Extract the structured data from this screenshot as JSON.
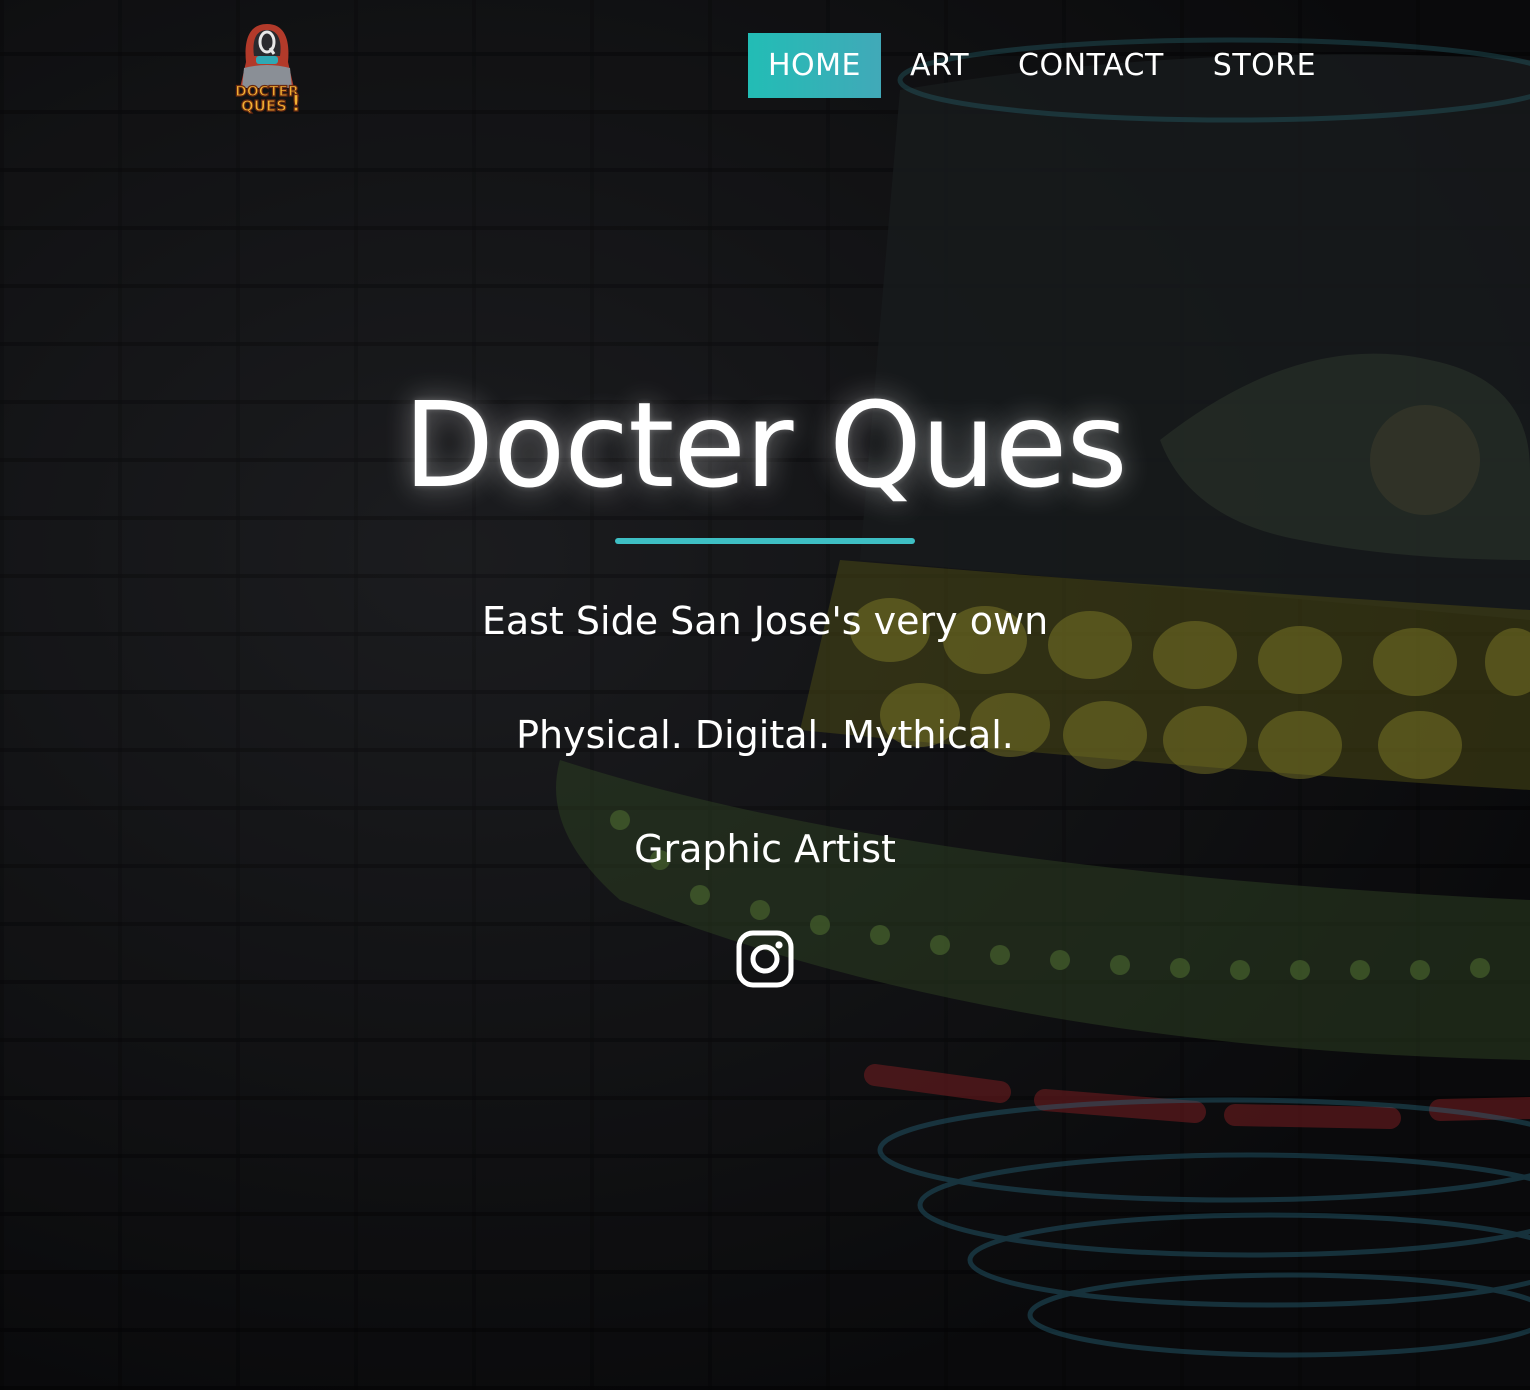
{
  "brand": {
    "logo_text_line1": "DOCTER",
    "logo_text_line2": "QUES!"
  },
  "nav": {
    "items": [
      {
        "label": "HOME",
        "active": true
      },
      {
        "label": "ART",
        "active": false
      },
      {
        "label": "CONTACT",
        "active": false
      },
      {
        "label": "STORE",
        "active": false
      }
    ],
    "active_color": "#22bdb5"
  },
  "hero": {
    "title": "Docter Ques",
    "line1": "East Side San Jose's very own",
    "line2": "Physical. Digital. Mythical.",
    "line3": "Graphic Artist",
    "social_icon": "instagram-icon"
  },
  "colors": {
    "accent": "#3ebfc4",
    "text": "#ffffff",
    "background": "#1a1b1d"
  }
}
